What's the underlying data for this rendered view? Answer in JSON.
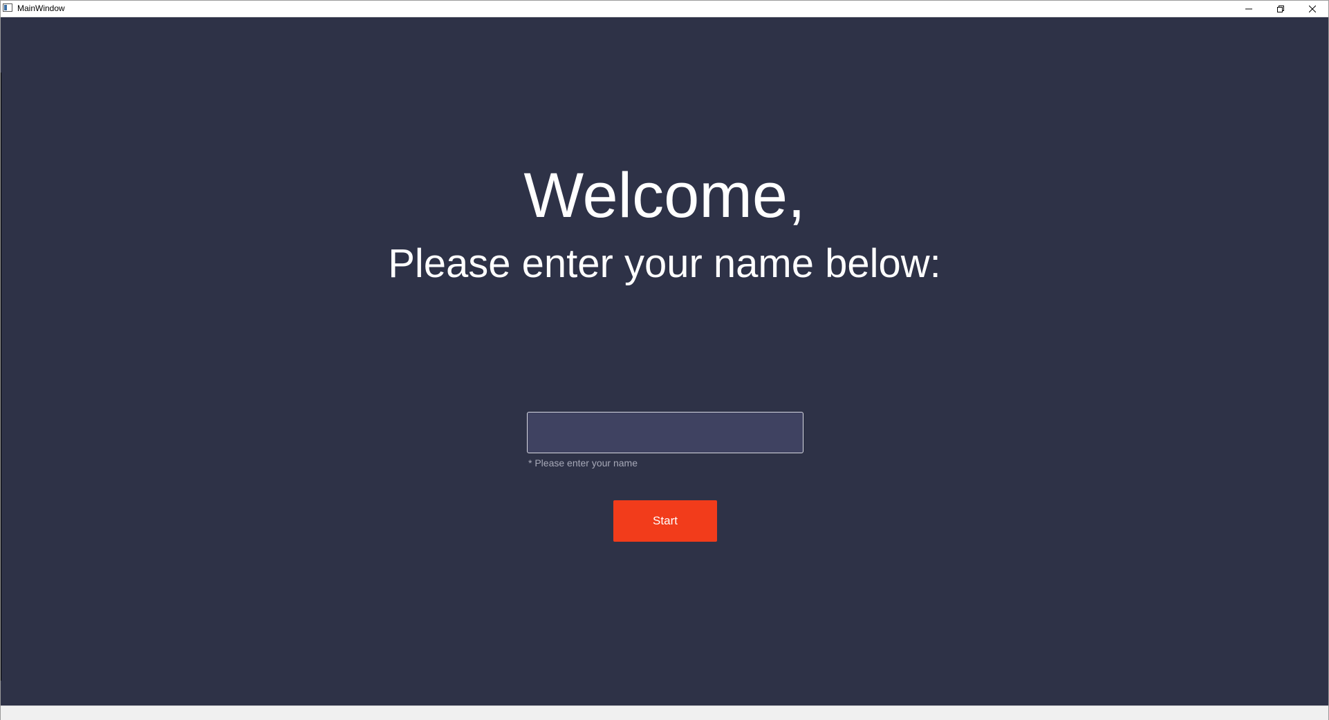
{
  "window": {
    "title": "MainWindow"
  },
  "titlebar_icons": {
    "app": "app-window-icon",
    "minimize": "minimize-icon",
    "maximize": "restore-icon",
    "close": "close-icon"
  },
  "main": {
    "heading": "Welcome,",
    "subheading": "Please enter your name below:",
    "name_input": {
      "value": "",
      "placeholder": ""
    },
    "hint": "* Please enter your name",
    "start_label": "Start"
  },
  "colors": {
    "background": "#2e3247",
    "input_background": "#3f4261",
    "accent": "#f23c1b",
    "text": "#ffffff",
    "hint": "#a7a9b8"
  }
}
